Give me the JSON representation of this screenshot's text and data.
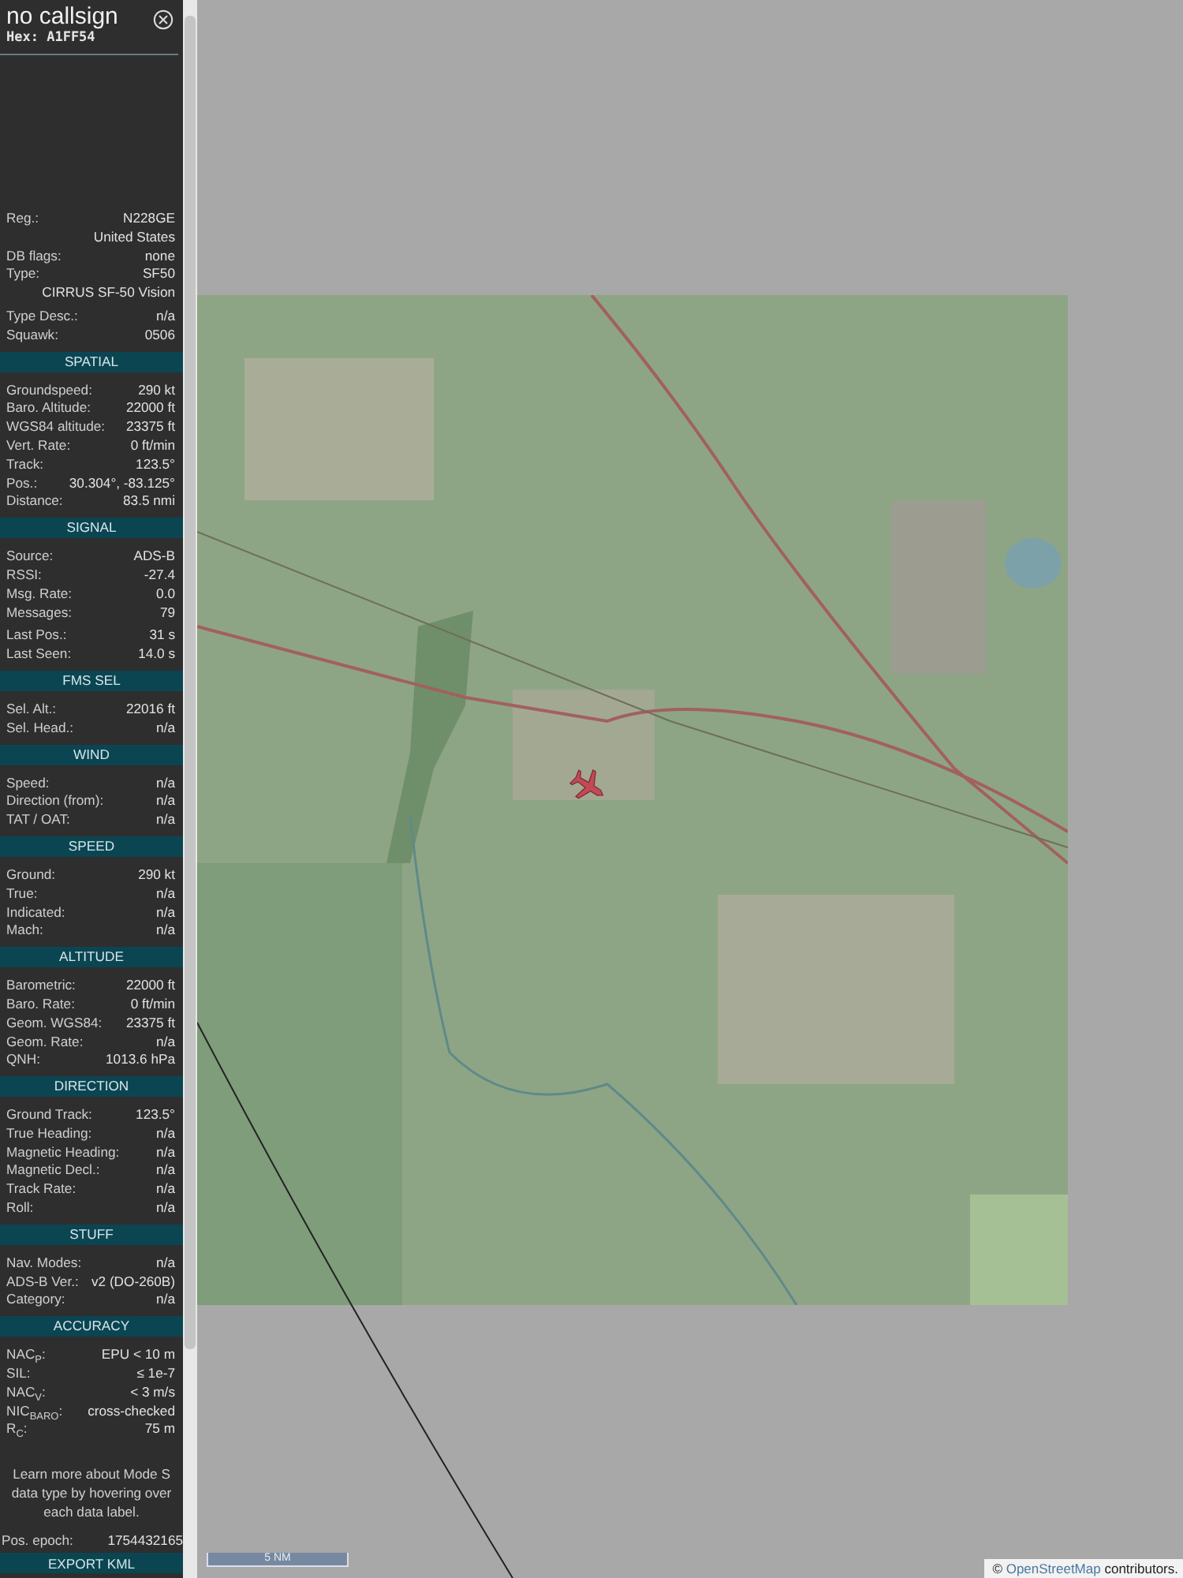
{
  "title": "no callsign",
  "hex": "Hex: A1FF54",
  "sections": [
    {
      "groups": [
        [
          {
            "kind": "pair",
            "label": "Reg.:",
            "value": "N228GE"
          },
          {
            "kind": "value",
            "value": "United States"
          },
          {
            "kind": "pair",
            "label": "DB flags:",
            "value": "none"
          },
          {
            "kind": "pair",
            "label": "Type:",
            "value": "SF50"
          },
          {
            "kind": "value",
            "value": "CIRRUS SF-50 Vision"
          }
        ],
        [
          {
            "kind": "pair",
            "label": "Type Desc.:",
            "value": "n/a"
          },
          {
            "kind": "pair",
            "label": "Squawk:",
            "value": "0506"
          }
        ]
      ]
    },
    {
      "title": "SPATIAL",
      "groups": [
        [
          {
            "kind": "pair",
            "label": "Groundspeed:",
            "value": "290 kt"
          },
          {
            "kind": "pair",
            "label": "Baro. Altitude:",
            "value": "22000 ft"
          },
          {
            "kind": "pair",
            "label": "WGS84 altitude:",
            "value": "23375 ft"
          },
          {
            "kind": "pair",
            "label": "Vert. Rate:",
            "value": "0 ft/min"
          },
          {
            "kind": "pair",
            "label": "Track:",
            "value": "123.5°"
          },
          {
            "kind": "pair",
            "label": "Pos.:",
            "value": "30.304°, -83.125°"
          },
          {
            "kind": "pair",
            "label": "Distance:",
            "value": "83.5 nmi"
          }
        ]
      ]
    },
    {
      "title": "SIGNAL",
      "groups": [
        [
          {
            "kind": "pair",
            "label": "Source:",
            "value": "ADS-B"
          },
          {
            "kind": "pair",
            "label": "RSSI:",
            "value": "-27.4"
          },
          {
            "kind": "pair",
            "label": "Msg. Rate:",
            "value": "0.0"
          },
          {
            "kind": "pair",
            "label": "Messages:",
            "value": "79"
          }
        ],
        [
          {
            "kind": "pair",
            "label": "Last Pos.:",
            "value": "31 s"
          },
          {
            "kind": "pair",
            "label": "Last Seen:",
            "value": "14.0 s"
          }
        ]
      ]
    },
    {
      "title": "FMS SEL",
      "groups": [
        [
          {
            "kind": "pair",
            "label": "Sel. Alt.:",
            "value": "22016 ft"
          },
          {
            "kind": "pair",
            "label": "Sel. Head.:",
            "value": "n/a"
          }
        ]
      ]
    },
    {
      "title": "WIND",
      "groups": [
        [
          {
            "kind": "pair",
            "label": "Speed:",
            "value": "n/a"
          },
          {
            "kind": "pair",
            "label": "Direction (from):",
            "value": "n/a"
          },
          {
            "kind": "pair",
            "label": "TAT / OAT:",
            "value": "n/a"
          }
        ]
      ]
    },
    {
      "title": "SPEED",
      "groups": [
        [
          {
            "kind": "pair",
            "label": "Ground:",
            "value": "290 kt"
          },
          {
            "kind": "pair",
            "label": "True:",
            "value": "n/a"
          },
          {
            "kind": "pair",
            "label": "Indicated:",
            "value": "n/a"
          },
          {
            "kind": "pair",
            "label": "Mach:",
            "value": "n/a"
          }
        ]
      ]
    },
    {
      "title": "ALTITUDE",
      "groups": [
        [
          {
            "kind": "pair",
            "label": "Barometric:",
            "value": "22000 ft"
          },
          {
            "kind": "pair",
            "label": "Baro. Rate:",
            "value": "0 ft/min"
          },
          {
            "kind": "pair",
            "label": "Geom. WGS84:",
            "value": "23375 ft"
          },
          {
            "kind": "pair",
            "label": "Geom. Rate:",
            "value": "n/a"
          },
          {
            "kind": "pair",
            "label": "QNH:",
            "value": "1013.6 hPa"
          }
        ]
      ]
    },
    {
      "title": "DIRECTION",
      "groups": [
        [
          {
            "kind": "pair",
            "label": "Ground Track:",
            "value": "123.5°"
          },
          {
            "kind": "pair",
            "label": "True Heading:",
            "value": "n/a"
          },
          {
            "kind": "pair",
            "label": "Magnetic Heading:",
            "value": "n/a"
          },
          {
            "kind": "pair",
            "label": "Magnetic Decl.:",
            "value": "n/a"
          },
          {
            "kind": "pair",
            "label": "Track Rate:",
            "value": "n/a"
          },
          {
            "kind": "pair",
            "label": "Roll:",
            "value": "n/a"
          }
        ]
      ]
    },
    {
      "title": "STUFF",
      "groups": [
        [
          {
            "kind": "pair",
            "label": "Nav. Modes:",
            "value": "n/a"
          },
          {
            "kind": "pair",
            "label": "ADS-B Ver.:",
            "value": "v2 (DO-260B)"
          },
          {
            "kind": "pair",
            "label": "Category:",
            "value": "n/a"
          }
        ]
      ]
    },
    {
      "title": "ACCURACY",
      "groups": [
        [
          {
            "kind": "pair",
            "label": "NAC$_{P}$:",
            "value": "EPU < 10 m"
          },
          {
            "kind": "pair",
            "label": "SIL:",
            "value": "≤ 1e-7"
          },
          {
            "kind": "pair",
            "label": "NAC$_{V}$:",
            "value": "< 3 m/s"
          },
          {
            "kind": "pair",
            "label": "NIC$_{BARO}$:",
            "value": "cross-checked"
          },
          {
            "kind": "pair",
            "label": "R$_{C}$:",
            "value": "75 m"
          }
        ]
      ]
    }
  ],
  "note": "Learn more about Mode S data type by hovering over each data label.",
  "pos_epoch": {
    "label": "Pos. epoch:",
    "value": "1754432165"
  },
  "export_button": "EXPORT KML",
  "map": {
    "scale": "5 NM",
    "attribution": {
      "prefix": "©",
      "link": "OpenStreetMap",
      "suffix": "contributors."
    }
  }
}
